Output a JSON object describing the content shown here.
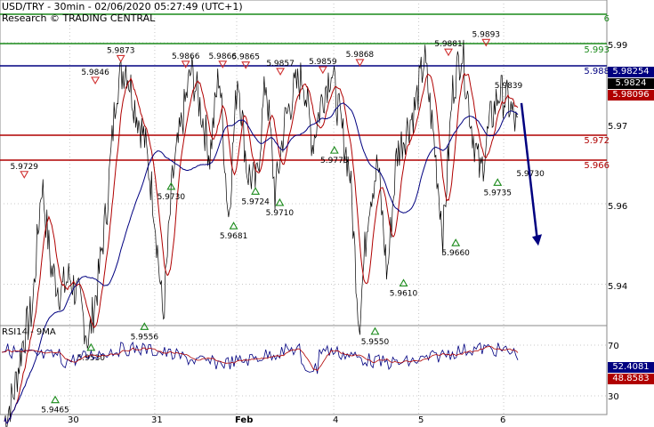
{
  "header": {
    "title": "USD/TRY - 30min - 02/06/2020 05:27:49 (UTC+1)",
    "subtitle": "Research © TRADING CENTRAL"
  },
  "colors": {
    "green": "#1a8a1a",
    "blue": "#000080",
    "red": "#b00000",
    "price": "#000000",
    "ma": "#b00000",
    "ma_slow": "#000080"
  },
  "levels": [
    {
      "label": "6",
      "value": 6.0,
      "color": "green"
    },
    {
      "label": "5.993",
      "value": 5.993,
      "color": "green"
    },
    {
      "label": "5.988",
      "value": 5.988,
      "color": "blue"
    },
    {
      "label": "5.972",
      "value": 5.972,
      "color": "red"
    },
    {
      "label": "5.966",
      "value": 5.966,
      "color": "red"
    }
  ],
  "y_ticks": [
    "5.99",
    "5.97",
    "5.96",
    "5.94"
  ],
  "badges": [
    {
      "text": "5.98254",
      "bg": "#000080",
      "fg": "#ffffff"
    },
    {
      "text": "5.9824",
      "bg": "#000000",
      "fg": "#ffffff"
    },
    {
      "text": "5.98096",
      "bg": "#b00000",
      "fg": "#ffffff"
    }
  ],
  "x_labels": [
    "30",
    "31",
    "Feb",
    "4",
    "5",
    "6"
  ],
  "rsi": {
    "title": "RSI14 - 9MA",
    "ticks": [
      "70",
      "30"
    ],
    "value": "52.4081",
    "ma_value": "48.8583"
  },
  "chart_data": {
    "type": "line",
    "title": "USD/TRY - 30min - 02/06/2020 05:27:49 (UTC+1)",
    "xlabel": "",
    "ylabel": "",
    "ylim": [
      5.93,
      6.0
    ],
    "x_categories": [
      "30",
      "31",
      "Feb",
      "4",
      "5",
      "6"
    ],
    "price_path": [
      5.943,
      5.9465,
      5.953,
      5.957,
      5.9729,
      5.962,
      5.959,
      5.961,
      5.958,
      5.953,
      5.96,
      5.97,
      5.9846,
      5.9873,
      5.982,
      5.978,
      5.97,
      5.9556,
      5.973,
      5.98,
      5.9866,
      5.982,
      5.976,
      5.9866,
      5.9681,
      5.9865,
      5.974,
      5.9724,
      5.9857,
      5.971,
      5.98,
      5.984,
      5.9859,
      5.9775,
      5.983,
      5.9868,
      5.98,
      5.974,
      5.955,
      5.97,
      5.975,
      5.961,
      5.976,
      5.979,
      5.982,
      5.9881,
      5.978,
      5.966,
      5.984,
      5.9893,
      5.98,
      5.9735,
      5.98,
      5.9839,
      5.9825,
      5.979
    ],
    "annotations": [
      {
        "text": "5.9729",
        "x": 0.04,
        "value": 5.9729,
        "type": "high"
      },
      {
        "text": "5.9465",
        "x": 0.091,
        "value": 5.9465,
        "type": "low"
      },
      {
        "text": "5.9846",
        "x": 0.157,
        "value": 5.9846,
        "type": "high"
      },
      {
        "text": "5.9530",
        "x": 0.15,
        "value": 5.953,
        "type": "low"
      },
      {
        "text": "5.9873",
        "x": 0.199,
        "value": 5.9873,
        "type": "high"
      },
      {
        "text": "5.9556",
        "x": 0.238,
        "value": 5.9556,
        "type": "low"
      },
      {
        "text": "5.9730",
        "x": 0.282,
        "value": 5.973,
        "type": "low"
      },
      {
        "text": "5.9866",
        "x": 0.306,
        "value": 5.9866,
        "type": "high"
      },
      {
        "text": "5.9866",
        "x": 0.367,
        "value": 5.9866,
        "type": "high"
      },
      {
        "text": "5.9681",
        "x": 0.385,
        "value": 5.9681,
        "type": "low"
      },
      {
        "text": "5.9865",
        "x": 0.405,
        "value": 5.9865,
        "type": "high"
      },
      {
        "text": "5.9724",
        "x": 0.421,
        "value": 5.9724,
        "type": "low"
      },
      {
        "text": "5.9857",
        "x": 0.462,
        "value": 5.9857,
        "type": "high"
      },
      {
        "text": "5.9710",
        "x": 0.461,
        "value": 5.971,
        "type": "low"
      },
      {
        "text": "5.9859",
        "x": 0.532,
        "value": 5.9859,
        "type": "high"
      },
      {
        "text": "5.9775",
        "x": 0.551,
        "value": 5.9775,
        "type": "low"
      },
      {
        "text": "5.9868",
        "x": 0.593,
        "value": 5.9868,
        "type": "high"
      },
      {
        "text": "5.9550",
        "x": 0.618,
        "value": 5.955,
        "type": "low"
      },
      {
        "text": "5.9610",
        "x": 0.665,
        "value": 5.961,
        "type": "low"
      },
      {
        "text": "5.9881",
        "x": 0.739,
        "value": 5.9881,
        "type": "high"
      },
      {
        "text": "5.9660",
        "x": 0.751,
        "value": 5.966,
        "type": "low"
      },
      {
        "text": "5.9893",
        "x": 0.801,
        "value": 5.9893,
        "type": "high"
      },
      {
        "text": "5.9735",
        "x": 0.82,
        "value": 5.9735,
        "type": "low"
      },
      {
        "text": "5.9839",
        "x": 0.838,
        "value": 5.9839,
        "type": "label"
      },
      {
        "text": "5.9730",
        "x": 0.874,
        "value": 5.973,
        "type": "label"
      }
    ],
    "forecast": {
      "from": 5.9825,
      "to": 5.966
    },
    "grid": true
  }
}
